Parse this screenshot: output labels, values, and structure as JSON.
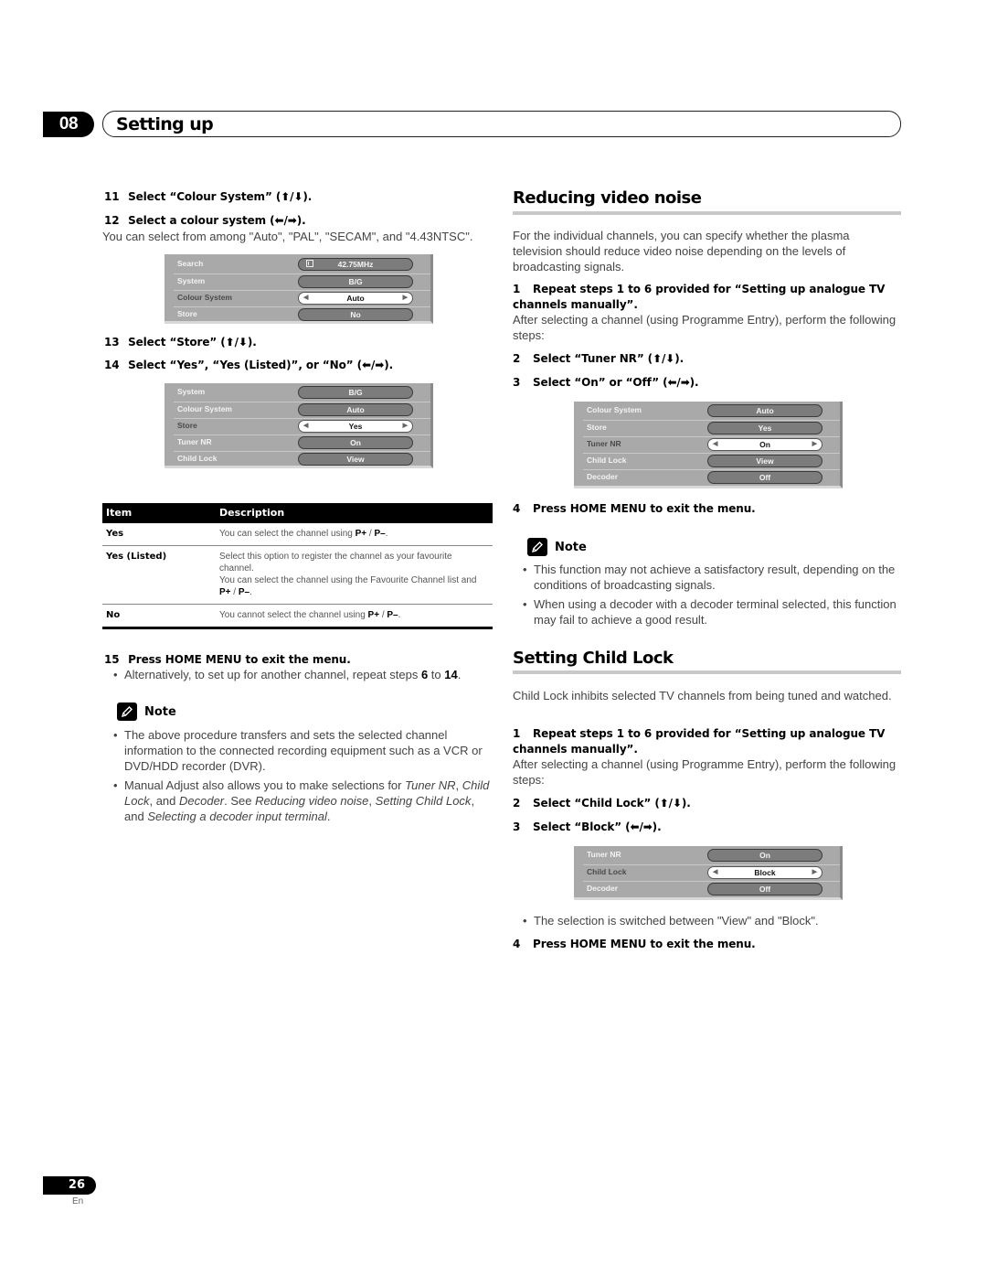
{
  "header": {
    "chapter_number": "08",
    "chapter_title": "Setting up"
  },
  "left": {
    "step11": {
      "num": "11",
      "text": "Select “Colour System” (⬆/⬇)."
    },
    "step12": {
      "num": "12",
      "text": "Select a colour system (⬅/➡)."
    },
    "step12_body": "You can select from among \"Auto\", \"PAL\", \"SECAM\", and \"4.43NTSC\".",
    "menu1": [
      {
        "label": "Search",
        "value": "42.75MHz",
        "icon": "search-bar-icon",
        "selected": false
      },
      {
        "label": "System",
        "value": "B/G",
        "selected": false
      },
      {
        "label": "Colour System",
        "value": "Auto",
        "selected": true
      },
      {
        "label": "Store",
        "value": "No",
        "selected": false
      }
    ],
    "step13": {
      "num": "13",
      "text": "Select “Store” (⬆/⬇)."
    },
    "step14": {
      "num": "14",
      "text": "Select “Yes”, “Yes (Listed)”, or “No” (⬅/➡)."
    },
    "menu2": [
      {
        "label": "System",
        "value": "B/G",
        "selected": false
      },
      {
        "label": "Colour System",
        "value": "Auto",
        "selected": false
      },
      {
        "label": "Store",
        "value": "Yes",
        "selected": true
      },
      {
        "label": "Tuner NR",
        "value": "On",
        "selected": false
      },
      {
        "label": "Child Lock",
        "value": "View",
        "selected": false
      }
    ],
    "table": {
      "headers": [
        "Item",
        "Description"
      ],
      "rows": [
        {
          "item": "Yes",
          "desc": [
            "You can select the channel using ",
            "P+",
            " / ",
            "P–",
            "."
          ]
        },
        {
          "item": "Yes (Listed)",
          "desc_lines": [
            "Select this option to register the channel as your favourite channel.",
            "You can select the channel using the Favourite Channel list and "
          ],
          "desc_tail": [
            "P+",
            " / ",
            "P–",
            "."
          ]
        },
        {
          "item": "No",
          "desc": [
            "You cannot select the channel using ",
            "P+",
            " / ",
            "P–",
            "."
          ]
        }
      ]
    },
    "step15": {
      "num": "15",
      "text": "Press HOME MENU to exit the menu."
    },
    "step15_bullet": {
      "pre": "Alternatively, to set up for another channel, repeat steps ",
      "a": "6",
      "mid": " to ",
      "b": "14",
      "post": "."
    },
    "note_label": "Note",
    "notes": [
      "The above procedure transfers and sets the selected channel information to the connected recording equipment such as a VCR or DVD/HDD recorder (DVR).",
      {
        "t1": "Manual Adjust also allows you to make selections for ",
        "i1": "Tuner NR",
        "t2": ", ",
        "i2": "Child Lock",
        "t3": ", and ",
        "i3": "Decoder",
        "t4": ". See ",
        "i4": "Reducing video noise",
        "t5": ", ",
        "i5": "Setting Child Lock",
        "t6": ", and ",
        "i6": "Selecting a decoder input terminal",
        "t7": "."
      }
    ]
  },
  "right": {
    "noise": {
      "title": "Reducing video noise",
      "intro": "For the individual channels, you can specify whether the plasma television should reduce video noise depending on the levels of broadcasting signals.",
      "step1": {
        "num": "1",
        "text": "Repeat steps 1 to 6 provided for “Setting up analogue TV channels manually”."
      },
      "step1_body": "After selecting a channel (using Programme Entry), perform the following steps:",
      "step2": {
        "num": "2",
        "text": "Select “Tuner NR” (⬆/⬇)."
      },
      "step3": {
        "num": "3",
        "text": "Select “On” or “Off” (⬅/➡)."
      },
      "menu": [
        {
          "label": "Colour System",
          "value": "Auto",
          "selected": false
        },
        {
          "label": "Store",
          "value": "Yes",
          "selected": false
        },
        {
          "label": "Tuner NR",
          "value": "On",
          "selected": true
        },
        {
          "label": "Child Lock",
          "value": "View",
          "selected": false
        },
        {
          "label": "Decoder",
          "value": "Off",
          "selected": false
        }
      ],
      "step4": {
        "num": "4",
        "text": "Press HOME MENU to exit the menu."
      },
      "note_label": "Note",
      "notes": [
        "This function may not achieve a satisfactory result, depending on the conditions of broadcasting signals.",
        "When using a decoder with a decoder terminal selected, this function may fail to achieve a good result."
      ]
    },
    "childlock": {
      "title": "Setting Child Lock",
      "intro": "Child Lock inhibits selected TV channels from being tuned and watched.",
      "step1": {
        "num": "1",
        "text": "Repeat steps 1 to 6 provided for “Setting up analogue TV channels manually”."
      },
      "step1_body": "After selecting a channel (using Programme Entry), perform the following steps:",
      "step2": {
        "num": "2",
        "text": "Select “Child Lock” (⬆/⬇)."
      },
      "step3": {
        "num": "3",
        "text": "Select “Block” (⬅/➡)."
      },
      "menu": [
        {
          "label": "Tuner NR",
          "value": "On",
          "selected": false
        },
        {
          "label": "Child Lock",
          "value": "Block",
          "selected": true
        },
        {
          "label": "Decoder",
          "value": "Off",
          "selected": false
        }
      ],
      "bullet": "The selection is switched between \"View\" and \"Block\".",
      "step4": {
        "num": "4",
        "text": "Press HOME MENU to exit the menu."
      }
    }
  },
  "footer": {
    "page_number": "26",
    "language": "En"
  }
}
